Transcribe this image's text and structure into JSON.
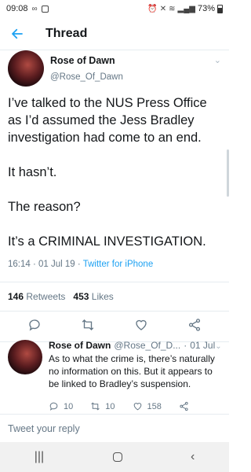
{
  "status_bar": {
    "time": "09:08",
    "battery_percent": "73%"
  },
  "header": {
    "title": "Thread"
  },
  "main_tweet": {
    "display_name": "Rose of Dawn",
    "handle": "@Rose_Of_Dawn",
    "paragraphs": [
      "I’ve talked to the NUS Press Office as I’d assumed the Jess Bradley investigation had come to an end.",
      "It hasn’t.",
      "The reason?",
      "It’s a CRIMINAL INVESTIGATION."
    ],
    "time": "16:14",
    "date": "01 Jul 19",
    "source": "Twitter for iPhone",
    "retweets_count": "146",
    "retweets_label": "Retweets",
    "likes_count": "453",
    "likes_label": "Likes"
  },
  "reply_tweet": {
    "display_name": "Rose of Dawn",
    "handle": "@Rose_Of_D...",
    "date": "01 Jul",
    "text": "As to what the crime is, there’s naturally no information on this. But it appears to be linked to Bradley’s suspension.",
    "replies": "10",
    "retweets": "10",
    "likes": "158"
  },
  "compose": {
    "placeholder": "Tweet your reply"
  },
  "colors": {
    "accent": "#1da1f2",
    "muted": "#657786",
    "border": "#e6ecf0"
  }
}
